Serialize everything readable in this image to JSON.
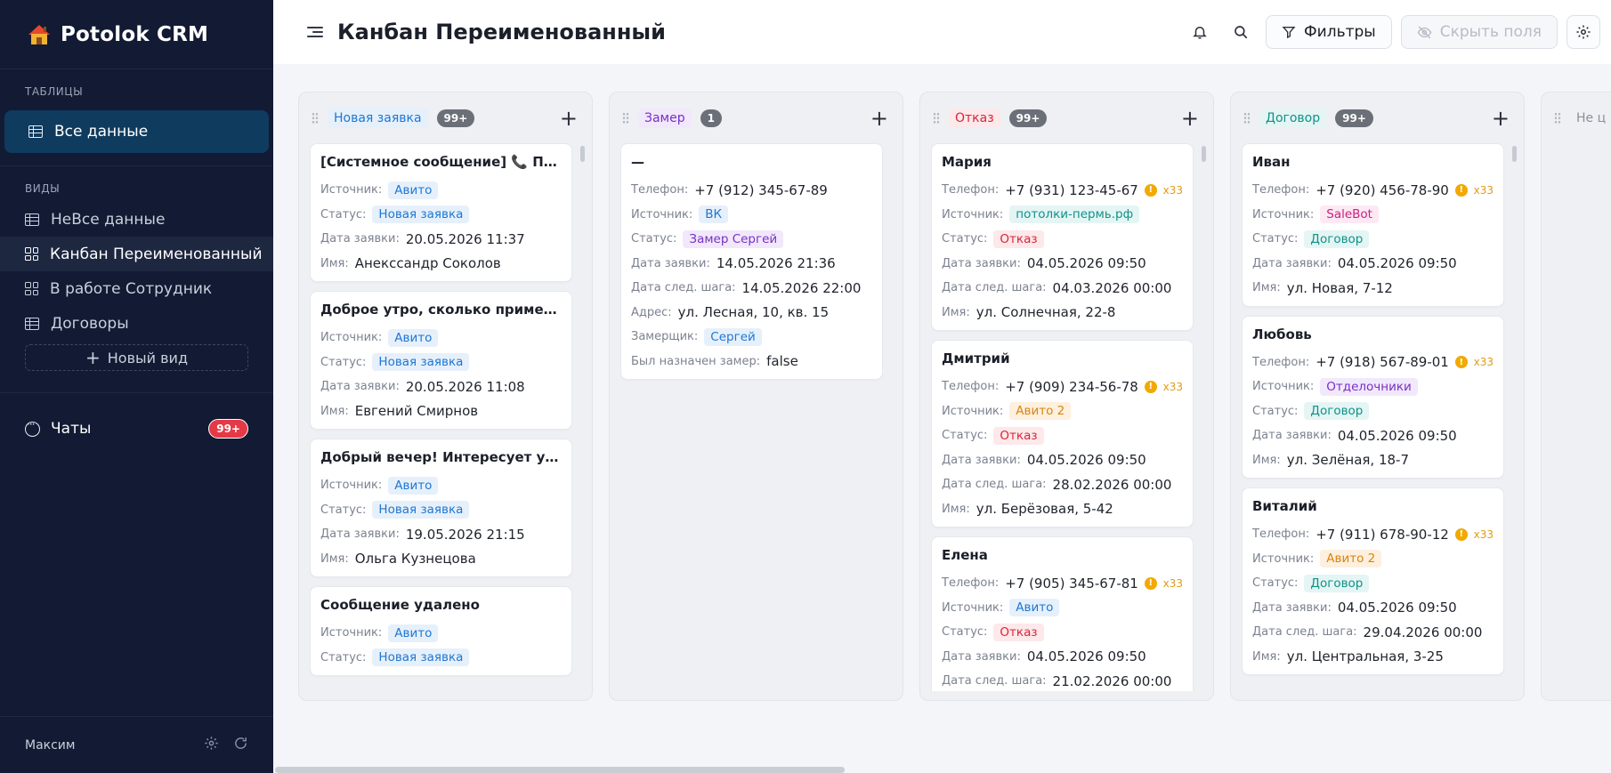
{
  "brand": {
    "name": "Potolok CRM"
  },
  "sidebar": {
    "tables_title": "ТАБЛИЦЫ",
    "tables": [
      {
        "label": "Все данные"
      }
    ],
    "views_title": "ВИДЫ",
    "views": [
      {
        "label": "НеВсе данные",
        "icon": "table-icon"
      },
      {
        "label": "Канбан Переименованный",
        "icon": "kanban-icon"
      },
      {
        "label": "В работе Сотрудник",
        "icon": "table-icon"
      },
      {
        "label": "Договоры",
        "icon": "table-icon"
      }
    ],
    "new_view": "Новый вид",
    "chats": {
      "label": "Чаты",
      "badge": "99+"
    },
    "footer_user": "Максим"
  },
  "header": {
    "title": "Канбан Переименованный",
    "filters_label": "Фильтры",
    "hide_fields_label": "Скрыть поля"
  },
  "columns": [
    {
      "title": "Новая заявка",
      "count": "99+",
      "color": "blue",
      "cards": [
        {
          "title": "[Системное сообщение] 📞 Пользователь",
          "rows": [
            {
              "k": "Источник:",
              "v": "Авито",
              "tag": "t-blue"
            },
            {
              "k": "Статус:",
              "v": "Новая заявка",
              "tag": "t-blue"
            },
            {
              "k": "Дата заявки:",
              "v": "20.05.2026 11:37"
            },
            {
              "k": "Имя:",
              "v": "Анекссандр Соколов"
            }
          ]
        },
        {
          "title": "Доброе утро, сколько примерно будет",
          "rows": [
            {
              "k": "Источник:",
              "v": "Авито",
              "tag": "t-blue"
            },
            {
              "k": "Статус:",
              "v": "Новая заявка",
              "tag": "t-blue"
            },
            {
              "k": "Дата заявки:",
              "v": "20.05.2026 11:08"
            },
            {
              "k": "Имя:",
              "v": "Евгений Смирнов"
            }
          ]
        },
        {
          "title": "Добрый вечер! Интересует установка",
          "rows": [
            {
              "k": "Источник:",
              "v": "Авито",
              "tag": "t-blue"
            },
            {
              "k": "Статус:",
              "v": "Новая заявка",
              "tag": "t-blue"
            },
            {
              "k": "Дата заявки:",
              "v": "19.05.2026 21:15"
            },
            {
              "k": "Имя:",
              "v": "Ольга Кузнецова"
            }
          ]
        },
        {
          "title": "Сообщение удалено",
          "rows": [
            {
              "k": "Источник:",
              "v": "Авито",
              "tag": "t-blue"
            },
            {
              "k": "Статус:",
              "v": "Новая заявка",
              "tag": "t-blue"
            }
          ]
        }
      ]
    },
    {
      "title": "Замер",
      "count": "1",
      "color": "purple",
      "cards": [
        {
          "title": "—",
          "rows": [
            {
              "k": "Телефон:",
              "v": "+7 (912) 345-67-89"
            },
            {
              "k": "Источник:",
              "v": "ВК",
              "tag": "t-blue"
            },
            {
              "k": "Статус:",
              "v": "Замер Сергей",
              "tag": "t-purple"
            },
            {
              "k": "Дата заявки:",
              "v": "14.05.2026 21:36"
            },
            {
              "k": "Дата след. шага:",
              "v": "14.05.2026 22:00"
            },
            {
              "k": "Адрес:",
              "v": "ул. Лесная, 10, кв. 15"
            },
            {
              "k": "Замерщик:",
              "v": "Сергей",
              "tag": "t-blue"
            },
            {
              "k": "Был назначен замер:",
              "v": "false"
            }
          ]
        }
      ]
    },
    {
      "title": "Отказ",
      "count": "99+",
      "color": "red",
      "cards": [
        {
          "title": "Мария",
          "rows": [
            {
              "k": "Телефон:",
              "v": "+7 (931) 123-45-67",
              "warn": "x33"
            },
            {
              "k": "Источник:",
              "v": "потолки-пермь.рф",
              "tag": "t-teal"
            },
            {
              "k": "Статус:",
              "v": "Отказ",
              "tag": "t-red"
            },
            {
              "k": "Дата заявки:",
              "v": "04.05.2026 09:50"
            },
            {
              "k": "Дата след. шага:",
              "v": "04.03.2026 00:00"
            },
            {
              "k": "Имя:",
              "v": "ул. Солнечная, 22-8"
            }
          ]
        },
        {
          "title": "Дмитрий",
          "rows": [
            {
              "k": "Телефон:",
              "v": "+7 (909) 234-56-78",
              "warn": "x33"
            },
            {
              "k": "Источник:",
              "v": "Авито 2",
              "tag": "t-orange"
            },
            {
              "k": "Статус:",
              "v": "Отказ",
              "tag": "t-red"
            },
            {
              "k": "Дата заявки:",
              "v": "04.05.2026 09:50"
            },
            {
              "k": "Дата след. шага:",
              "v": "28.02.2026 00:00"
            },
            {
              "k": "Имя:",
              "v": "ул. Берёзовая, 5-42"
            }
          ]
        },
        {
          "title": "Елена",
          "rows": [
            {
              "k": "Телефон:",
              "v": "+7 (905) 345-67-81",
              "warn": "x33"
            },
            {
              "k": "Источник:",
              "v": "Авито",
              "tag": "t-blue"
            },
            {
              "k": "Статус:",
              "v": "Отказ",
              "tag": "t-red"
            },
            {
              "k": "Дата заявки:",
              "v": "04.05.2026 09:50"
            },
            {
              "k": "Дата след. шага:",
              "v": "21.02.2026 00:00"
            }
          ]
        }
      ]
    },
    {
      "title": "Договор",
      "count": "99+",
      "color": "teal",
      "cards": [
        {
          "title": "Иван",
          "rows": [
            {
              "k": "Телефон:",
              "v": "+7 (920) 456-78-90",
              "warn": "x33"
            },
            {
              "k": "Источник:",
              "v": "SaleBot",
              "tag": "t-pink"
            },
            {
              "k": "Статус:",
              "v": "Договор",
              "tag": "t-teal"
            },
            {
              "k": "Дата заявки:",
              "v": "04.05.2026 09:50"
            },
            {
              "k": "Имя:",
              "v": "ул. Новая, 7-12"
            }
          ]
        },
        {
          "title": "Любовь",
          "rows": [
            {
              "k": "Телефон:",
              "v": "+7 (918) 567-89-01",
              "warn": "x33"
            },
            {
              "k": "Источник:",
              "v": "Отделочники",
              "tag": "t-purple"
            },
            {
              "k": "Статус:",
              "v": "Договор",
              "tag": "t-teal"
            },
            {
              "k": "Дата заявки:",
              "v": "04.05.2026 09:50"
            },
            {
              "k": "Имя:",
              "v": "ул. Зелёная, 18-7"
            }
          ]
        },
        {
          "title": "Виталий",
          "rows": [
            {
              "k": "Телефон:",
              "v": "+7 (911) 678-90-12",
              "warn": "x33"
            },
            {
              "k": "Источник:",
              "v": "Авито 2",
              "tag": "t-orange"
            },
            {
              "k": "Статус:",
              "v": "Договор",
              "tag": "t-teal"
            },
            {
              "k": "Дата заявки:",
              "v": "04.05.2026 09:50"
            },
            {
              "k": "Дата след. шага:",
              "v": "29.04.2026 00:00"
            },
            {
              "k": "Имя:",
              "v": "ул. Центральная, 3-25"
            }
          ]
        }
      ]
    },
    {
      "title": "Не ц",
      "count": "",
      "color": "gray",
      "cards": []
    }
  ],
  "colors": {
    "sidebar_bg": "#121b33",
    "active_nav": "#0f3b5e",
    "badge_red": "#e53946",
    "blue": "#1e77d3",
    "purple": "#7a2fc7",
    "red": "#d7263a",
    "teal": "#109289"
  }
}
